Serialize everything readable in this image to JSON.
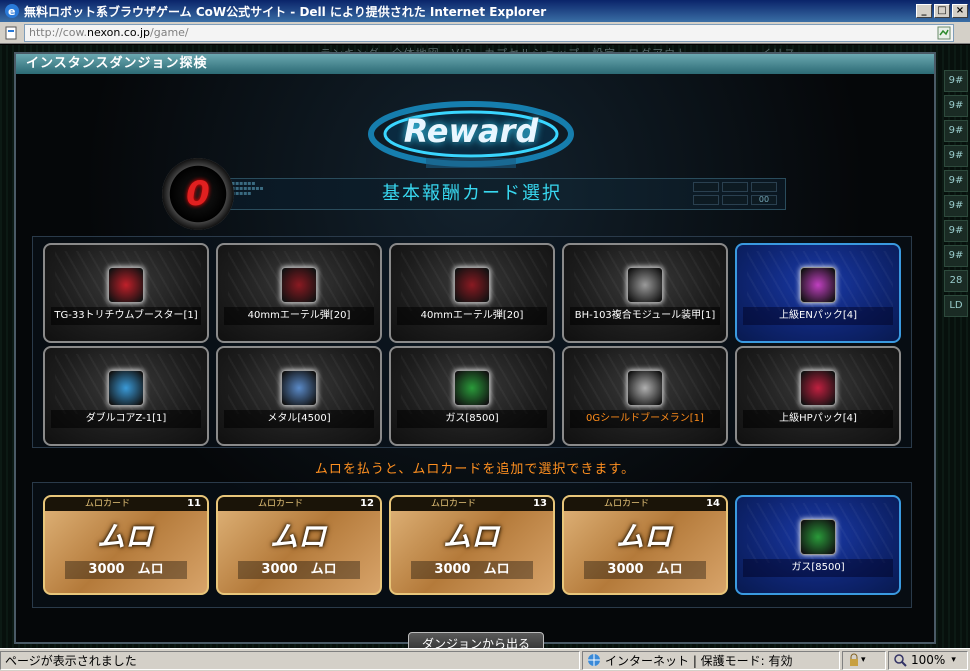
{
  "window": {
    "title": "無料ロボット系ブラウザゲーム CoW公式サイト - Dell により提供された Internet Explorer",
    "address_prefix": "http://cow.",
    "address_domain": "nexon.co.jp",
    "address_suffix": "/game/",
    "min_glyph": "_",
    "max_glyph": "□",
    "close_glyph": "×"
  },
  "background_nav": "ランキング　全体地図　VIP　カプセルショップ　設定　ログアウト　　　　　　イリス",
  "right_strip": [
    "9#",
    "9#",
    "9#",
    "9#",
    "9#",
    "9#",
    "9#",
    "9#",
    "28",
    "LD"
  ],
  "dialog": {
    "header": "インスタンスダンジョン探検",
    "reward_logo": "Reward",
    "counter": "0",
    "title": "基本報酬カード選択",
    "title_slot_value": "00",
    "basic_cards": [
      {
        "label": "TG-33トリチウムブースター[1]",
        "icon_color": "#c0202a",
        "highlight": false,
        "orange": false
      },
      {
        "label": "40mmエーテル弾[20]",
        "icon_color": "#8a1a22",
        "highlight": false,
        "orange": false
      },
      {
        "label": "40mmエーテル弾[20]",
        "icon_color": "#8a1a22",
        "highlight": false,
        "orange": false
      },
      {
        "label": "BH-103複合モジュール装甲[1]",
        "icon_color": "#9a9a9a",
        "highlight": false,
        "orange": false
      },
      {
        "label": "上級ENパック[4]",
        "icon_color": "#c040c0",
        "highlight": true,
        "orange": false
      },
      {
        "label": "ダブルコアZ-1[1]",
        "icon_color": "#3a9ad8",
        "highlight": false,
        "orange": false
      },
      {
        "label": "メタル[4500]",
        "icon_color": "#5a8ac8",
        "highlight": false,
        "orange": false
      },
      {
        "label": "ガス[8500]",
        "icon_color": "#2a9a3a",
        "highlight": false,
        "orange": false
      },
      {
        "label": "0Gシールドブーメラン[1]",
        "icon_color": "#b0b0b0",
        "highlight": false,
        "orange": true
      },
      {
        "label": "上級HPパック[4]",
        "icon_color": "#c02040",
        "highlight": false,
        "orange": false
      }
    ],
    "hint": "ムロを払うと、ムロカードを追加で選択できます。",
    "muro_cards": [
      {
        "head": "ムロカード",
        "num": "11",
        "logo": "ムロ",
        "price": "3000　ムロ"
      },
      {
        "head": "ムロカード",
        "num": "12",
        "logo": "ムロ",
        "price": "3000　ムロ"
      },
      {
        "head": "ムロカード",
        "num": "13",
        "logo": "ムロ",
        "price": "3000　ムロ"
      },
      {
        "head": "ムロカード",
        "num": "14",
        "logo": "ムロ",
        "price": "3000　ムロ"
      }
    ],
    "muro_selected": {
      "label": "ガス[8500]",
      "icon_color": "#2a9a3a"
    },
    "exit_button": "ダンジョンから出る"
  },
  "statusbar": {
    "message": "ページが表示されました",
    "zone": "インターネット | 保護モード: 有効",
    "zoom": "100%"
  }
}
